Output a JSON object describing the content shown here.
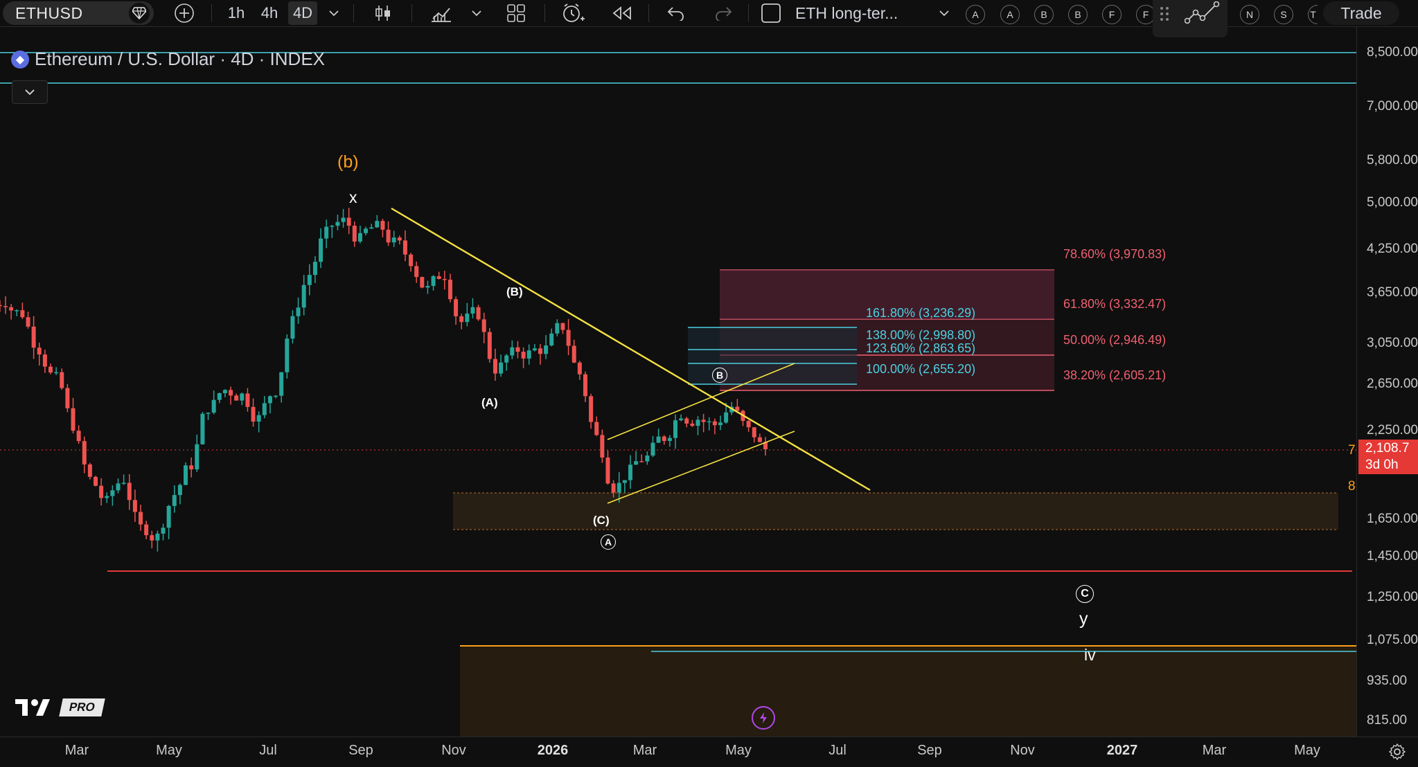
{
  "toolbar": {
    "symbol": "ETHUSD",
    "intervals": [
      "1h",
      "4h",
      "4D"
    ],
    "active_interval": "4D",
    "layout_name": "ETH long-ter...",
    "watch_circles": [
      "A",
      "A",
      "B",
      "B",
      "F",
      "F",
      "N",
      "S",
      "T"
    ],
    "trade_label": "Trade"
  },
  "legend": {
    "title": "Ethereum / U.S. Dollar · 4D · INDEX"
  },
  "price_axis": {
    "labels": [
      "8,500.00",
      "7,000.00",
      "5,800.00",
      "5,000.00",
      "4,250.00",
      "3,650.00",
      "3,050.00",
      "2,650.00",
      "2,250.00",
      "1,650.00",
      "1,450.00",
      "1,250.00",
      "1,075.00",
      "935.00",
      "815.00"
    ],
    "current_price": "2,108.7",
    "countdown": "3d 0h",
    "side_marks": [
      "7",
      "8"
    ]
  },
  "time_axis": {
    "labels": [
      "Mar",
      "May",
      "Jul",
      "Sep",
      "Nov",
      "2026",
      "Mar",
      "May",
      "Jul",
      "Sep",
      "Nov",
      "2027",
      "Mar",
      "May"
    ]
  },
  "fib_retracement": [
    {
      "level": "78.60% (3,970.83)"
    },
    {
      "level": "61.80% (3,332.47)"
    },
    {
      "level": "50.00% (2,946.49)"
    },
    {
      "level": "38.20% (2,605.21)"
    }
  ],
  "fib_extension": [
    {
      "level": "161.80% (3,236.29)"
    },
    {
      "level": "138.00% (2,998.80)"
    },
    {
      "level": "123.60% (2,863.65)"
    },
    {
      "level": "100.00% (2,655.20)"
    }
  ],
  "wave_labels": {
    "b_orange": "(b)",
    "x": "x",
    "B_small": "(B)",
    "A_small": "(A)",
    "C_small": "(C)",
    "A_circle": "A",
    "B_circle": "B",
    "C_circle": "C",
    "y": "y",
    "iv": "iv"
  },
  "brand": {
    "pro_label": "PRO"
  },
  "colors": {
    "up": "#26a69a",
    "down": "#ef5350",
    "trendline": "#f5e142",
    "cyan": "#4dd0e1",
    "fib_red": "#f06070",
    "wave_orange": "#ff9f1a",
    "price_tag": "#e53935"
  },
  "chart_data": {
    "type": "candlestick",
    "symbol": "ETHUSD",
    "interval": "4D",
    "close_series": [
      3550,
      3400,
      3000,
      2700,
      2300,
      1900,
      1750,
      1900,
      1600,
      1550,
      1800,
      2000,
      2450,
      2600,
      2550,
      2350,
      2600,
      3300,
      3900,
      4500,
      4700,
      4400,
      4600,
      4350,
      4100,
      3700,
      3900,
      3300,
      3400,
      2800,
      2950,
      2950,
      3000,
      3250,
      2750,
      2200,
      1850,
      1950,
      2050,
      2200,
      2400,
      2350,
      2300,
      2450,
      2250,
      2110
    ]
  }
}
